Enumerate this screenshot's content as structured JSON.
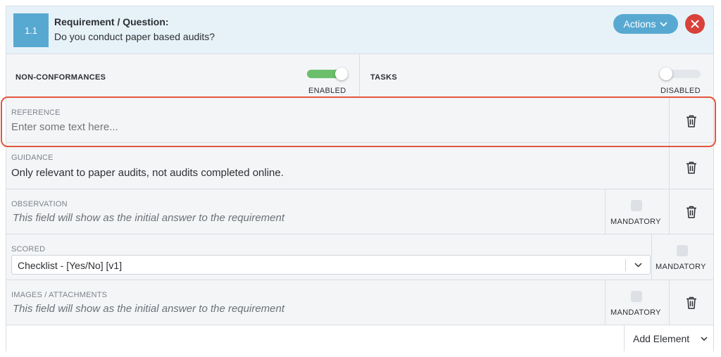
{
  "header": {
    "number": "1.1",
    "title": "Requirement / Question:",
    "question": "Do you conduct paper based audits?",
    "actions_label": "Actions"
  },
  "toggles": {
    "non_conformances": {
      "label": "NON-CONFORMANCES",
      "state": "ENABLED",
      "enabled": true
    },
    "tasks": {
      "label": "TASKS",
      "state": "DISABLED",
      "enabled": false
    }
  },
  "fields": {
    "reference": {
      "label": "REFERENCE",
      "placeholder": "Enter some text here..."
    },
    "guidance": {
      "label": "GUIDANCE",
      "value": "Only relevant to paper audits, not audits completed online."
    },
    "observation": {
      "label": "OBSERVATION",
      "hint": "This field will show as the initial answer to the requirement",
      "mandatory_label": "MANDATORY"
    },
    "scored": {
      "label": "SCORED",
      "selected": "Checklist - [Yes/No] [v1]",
      "mandatory_label": "MANDATORY"
    },
    "images": {
      "label": "IMAGES / ATTACHMENTS",
      "hint": "This field will show as the initial answer to the requirement",
      "mandatory_label": "MANDATORY"
    }
  },
  "footer": {
    "add_element_label": "Add Element"
  },
  "colors": {
    "accent": "#58a9d1",
    "danger": "#d9413b",
    "enabled": "#6cbf6a",
    "highlight": "#e0573e"
  }
}
